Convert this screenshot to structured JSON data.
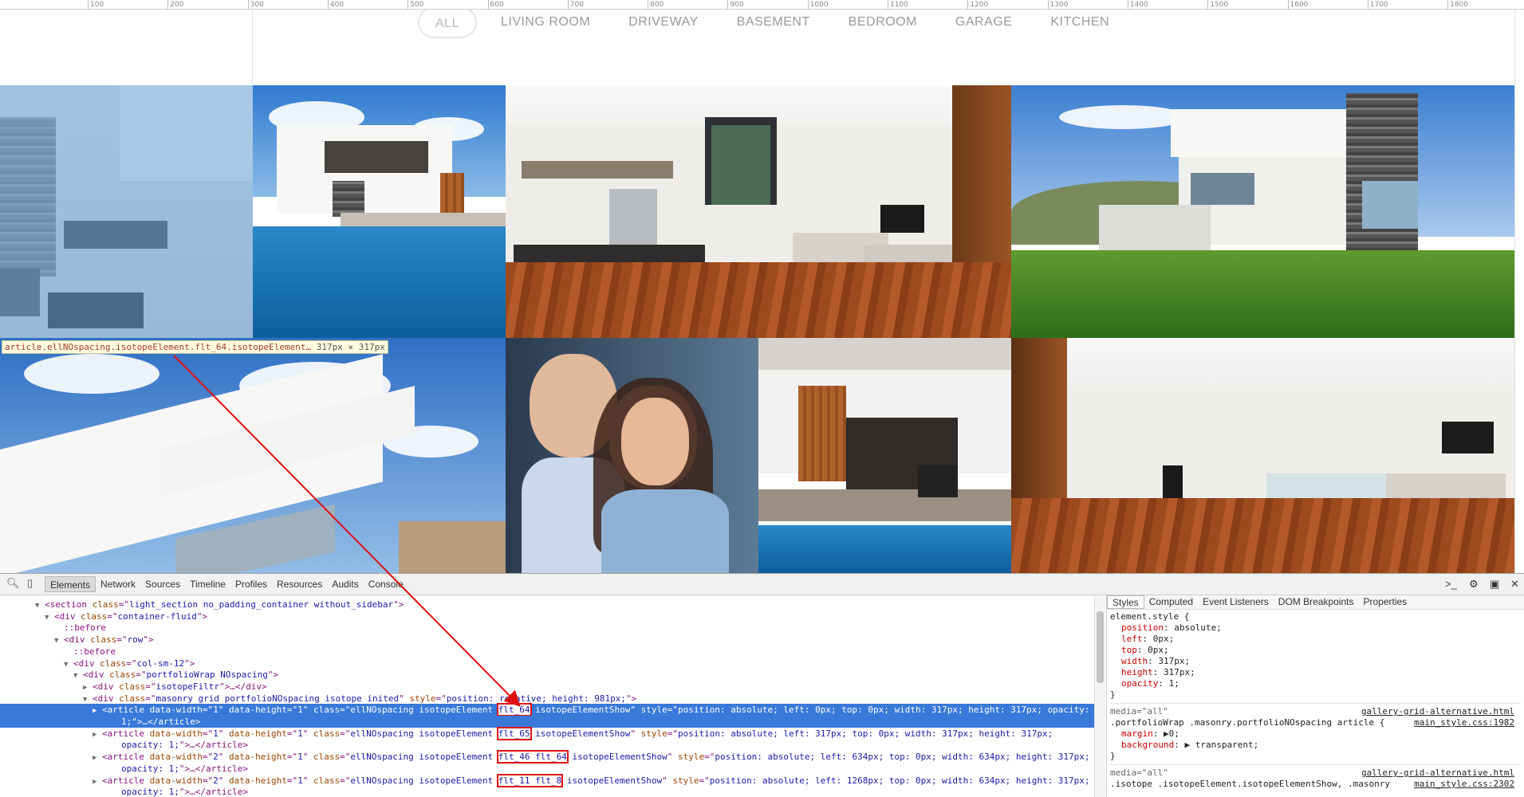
{
  "ruler": {
    "marks": [
      "100",
      "200",
      "300",
      "400",
      "500",
      "600",
      "700",
      "800",
      "900",
      "1000",
      "1100",
      "1200",
      "1300",
      "1400",
      "1500",
      "1600",
      "1700",
      "1800"
    ]
  },
  "filters": [
    "ALL",
    "LIVING ROOM",
    "DRIVEWAY",
    "BASEMENT",
    "BEDROOM",
    "GARAGE",
    "KITCHEN"
  ],
  "inspector_tooltip": {
    "selector": "article.ellNOspacing.isotopeElement.flt_64.isotopeElement…",
    "size": "317px × 317px"
  },
  "devtools": {
    "tabs": [
      "Elements",
      "Network",
      "Sources",
      "Timeline",
      "Profiles",
      "Resources",
      "Audits",
      "Console"
    ],
    "active_tab": "Elements",
    "dom_lines": [
      {
        "indent": 4,
        "tri": "▼",
        "parts": [
          [
            "tg",
            "<section "
          ],
          [
            "an",
            "class"
          ],
          [
            "tg",
            "=\""
          ],
          [
            "av",
            "light_section no_padding_container without_sidebar"
          ],
          [
            "tg",
            "\">"
          ]
        ]
      },
      {
        "indent": 5,
        "tri": "▼",
        "parts": [
          [
            "tg",
            "<div "
          ],
          [
            "an",
            "class"
          ],
          [
            "tg",
            "=\""
          ],
          [
            "av",
            "container-fluid"
          ],
          [
            "tg",
            "\">"
          ]
        ]
      },
      {
        "indent": 6,
        "tri": "",
        "parts": [
          [
            "pc",
            "::before"
          ]
        ]
      },
      {
        "indent": 6,
        "tri": "▼",
        "parts": [
          [
            "tg",
            "<div "
          ],
          [
            "an",
            "class"
          ],
          [
            "tg",
            "=\""
          ],
          [
            "av",
            "row"
          ],
          [
            "tg",
            "\">"
          ]
        ]
      },
      {
        "indent": 7,
        "tri": "",
        "parts": [
          [
            "pc",
            "::before"
          ]
        ]
      },
      {
        "indent": 7,
        "tri": "▼",
        "parts": [
          [
            "tg",
            "<div "
          ],
          [
            "an",
            "class"
          ],
          [
            "tg",
            "=\""
          ],
          [
            "av",
            "col-sm-12"
          ],
          [
            "tg",
            "\">"
          ]
        ]
      },
      {
        "indent": 8,
        "tri": "▼",
        "parts": [
          [
            "tg",
            "<div "
          ],
          [
            "an",
            "class"
          ],
          [
            "tg",
            "=\""
          ],
          [
            "av",
            "portfolioWrap NOspacing"
          ],
          [
            "tg",
            "\">"
          ]
        ]
      },
      {
        "indent": 9,
        "tri": "▶",
        "parts": [
          [
            "tg",
            "<div "
          ],
          [
            "an",
            "class"
          ],
          [
            "tg",
            "=\""
          ],
          [
            "av",
            "isotopeFiltr"
          ],
          [
            "tg",
            "\">…</div>"
          ]
        ]
      },
      {
        "indent": 9,
        "tri": "▼",
        "parts": [
          [
            "tg",
            "<div "
          ],
          [
            "an",
            "class"
          ],
          [
            "tg",
            "=\""
          ],
          [
            "av",
            "masonry grid portfolioNOspacing isotope inited"
          ],
          [
            "tg",
            "\" "
          ],
          [
            "an",
            "style"
          ],
          [
            "tg",
            "=\""
          ],
          [
            "av",
            "position: relative; height: 981px;"
          ],
          [
            "tg",
            "\">"
          ]
        ]
      },
      {
        "indent": 10,
        "tri": "▶",
        "selected": true,
        "parts": [
          [
            "tg",
            "<article "
          ],
          [
            "an",
            "data-width"
          ],
          [
            "tg",
            "=\""
          ],
          [
            "av",
            "1"
          ],
          [
            "tg",
            "\" "
          ],
          [
            "an",
            "data-height"
          ],
          [
            "tg",
            "=\""
          ],
          [
            "av",
            "1"
          ],
          [
            "tg",
            "\" "
          ],
          [
            "an",
            "class"
          ],
          [
            "tg",
            "=\""
          ],
          [
            "av",
            "ellNOspacing isotopeElement "
          ],
          [
            "hl",
            "flt_64"
          ],
          [
            "av",
            " isotopeElementShow"
          ],
          [
            "tg",
            "\" "
          ],
          [
            "an",
            "style"
          ],
          [
            "tg",
            "=\""
          ],
          [
            "av",
            "position: absolute; left: 0px; top: 0px; width: 317px; height: 317px; opacity:"
          ]
        ]
      },
      {
        "indent": 12,
        "tri": "",
        "selected": true,
        "parts": [
          [
            "av",
            "1;"
          ],
          [
            "tg",
            "\">…</article>"
          ]
        ]
      },
      {
        "indent": 10,
        "tri": "▶",
        "parts": [
          [
            "tg",
            "<article "
          ],
          [
            "an",
            "data-width"
          ],
          [
            "tg",
            "=\""
          ],
          [
            "av",
            "1"
          ],
          [
            "tg",
            "\" "
          ],
          [
            "an",
            "data-height"
          ],
          [
            "tg",
            "=\""
          ],
          [
            "av",
            "1"
          ],
          [
            "tg",
            "\" "
          ],
          [
            "an",
            "class"
          ],
          [
            "tg",
            "=\""
          ],
          [
            "av",
            "ellNOspacing isotopeElement "
          ],
          [
            "hl",
            "flt_65"
          ],
          [
            "av",
            " isotopeElementShow"
          ],
          [
            "tg",
            "\" "
          ],
          [
            "an",
            "style"
          ],
          [
            "tg",
            "=\""
          ],
          [
            "av",
            "position: absolute; left: 317px; top: 0px; width: 317px; height: 317px;"
          ]
        ]
      },
      {
        "indent": 12,
        "tri": "",
        "parts": [
          [
            "av",
            "opacity: 1;"
          ],
          [
            "tg",
            "\">…</article>"
          ]
        ]
      },
      {
        "indent": 10,
        "tri": "▶",
        "parts": [
          [
            "tg",
            "<article "
          ],
          [
            "an",
            "data-width"
          ],
          [
            "tg",
            "=\""
          ],
          [
            "av",
            "2"
          ],
          [
            "tg",
            "\" "
          ],
          [
            "an",
            "data-height"
          ],
          [
            "tg",
            "=\""
          ],
          [
            "av",
            "1"
          ],
          [
            "tg",
            "\" "
          ],
          [
            "an",
            "class"
          ],
          [
            "tg",
            "=\""
          ],
          [
            "av",
            "ellNOspacing isotopeElement "
          ],
          [
            "hl",
            "flt_46 flt_64"
          ],
          [
            "av",
            " isotopeElementShow"
          ],
          [
            "tg",
            "\" "
          ],
          [
            "an",
            "style"
          ],
          [
            "tg",
            "=\""
          ],
          [
            "av",
            "position: absolute; left: 634px; top: 0px; width: 634px; height: 317px;"
          ]
        ]
      },
      {
        "indent": 12,
        "tri": "",
        "parts": [
          [
            "av",
            "opacity: 1;"
          ],
          [
            "tg",
            "\">…</article>"
          ]
        ]
      },
      {
        "indent": 10,
        "tri": "▶",
        "parts": [
          [
            "tg",
            "<article "
          ],
          [
            "an",
            "data-width"
          ],
          [
            "tg",
            "=\""
          ],
          [
            "av",
            "2"
          ],
          [
            "tg",
            "\" "
          ],
          [
            "an",
            "data-height"
          ],
          [
            "tg",
            "=\""
          ],
          [
            "av",
            "1"
          ],
          [
            "tg",
            "\" "
          ],
          [
            "an",
            "class"
          ],
          [
            "tg",
            "=\""
          ],
          [
            "av",
            "ellNOspacing isotopeElement "
          ],
          [
            "hl",
            "flt_11 flt_8"
          ],
          [
            "av",
            " isotopeElementShow"
          ],
          [
            "tg",
            "\" "
          ],
          [
            "an",
            "style"
          ],
          [
            "tg",
            "=\""
          ],
          [
            "av",
            "position: absolute; left: 1268px; top: 0px; width: 634px; height: 317px;"
          ]
        ]
      },
      {
        "indent": 12,
        "tri": "",
        "parts": [
          [
            "av",
            "opacity: 1;"
          ],
          [
            "tg",
            "\">…</article>"
          ]
        ]
      }
    ],
    "styles_tabs": [
      "Styles",
      "Computed",
      "Event Listeners",
      "DOM Breakpoints",
      "Properties"
    ],
    "element_style": {
      "header": "element.style {",
      "props": [
        [
          "position",
          "absolute;"
        ],
        [
          "left",
          "0px;"
        ],
        [
          "top",
          "0px;"
        ],
        [
          "width",
          "317px;"
        ],
        [
          "height",
          "317px;"
        ],
        [
          "opacity",
          "1;"
        ]
      ],
      "close": "}"
    },
    "rule2": {
      "media": "media=\"all\"",
      "source": "gallery-grid-alternative.html",
      "selector": ".portfolioWrap .masonry.portfolioNOspacing article {",
      "source2": "main_style.css:1982",
      "props": [
        [
          "margin",
          "▶0;"
        ],
        [
          "background",
          "▶ transparent;"
        ]
      ],
      "close": "}"
    },
    "rule3": {
      "media": "media=\"all\"",
      "source": "gallery-grid-alternative.html",
      "selector": ".isotope .isotopeElement.isotopeElementShow, .masonry",
      "source2": "main_style.css:2302"
    }
  }
}
